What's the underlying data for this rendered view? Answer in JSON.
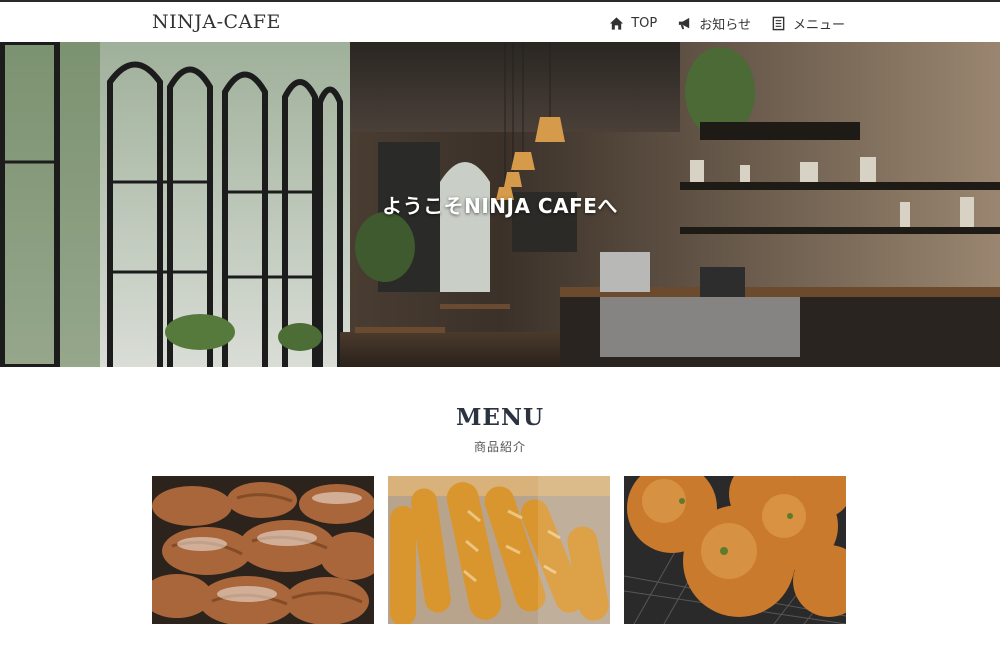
{
  "header": {
    "logo": "NINJA-CAFE",
    "nav": [
      {
        "label": "TOP",
        "icon": "home-icon"
      },
      {
        "label": "お知らせ",
        "icon": "megaphone-icon"
      },
      {
        "label": "メニュー",
        "icon": "menu-book-icon"
      }
    ]
  },
  "hero": {
    "title": "ようこそNINJA CAFEへ",
    "image": "cafe-interior-photo"
  },
  "menu": {
    "heading": "MENU",
    "subheading": "商品紹介",
    "items": [
      {
        "image": "croissant-photo"
      },
      {
        "image": "baguette-photo"
      },
      {
        "image": "curry-bread-photo"
      }
    ]
  }
}
